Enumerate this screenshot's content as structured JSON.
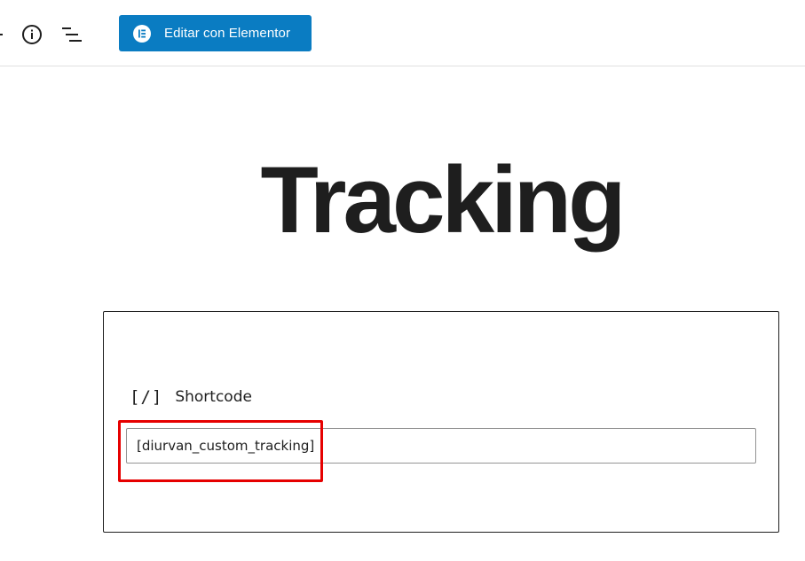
{
  "toolbar": {
    "info_icon": "info-circle-icon",
    "outline_icon": "list-outline-icon",
    "elementor_button": {
      "label": "Editar con Elementor",
      "icon": "elementor-logo-icon",
      "color": "#0a7cc2"
    }
  },
  "post": {
    "title": "Tracking"
  },
  "shortcode_block": {
    "icon_glyph": "[/]",
    "title": "Shortcode",
    "input_value": "[diurvan_custom_tracking]"
  },
  "annotation": {
    "highlight_color": "#e60000"
  }
}
